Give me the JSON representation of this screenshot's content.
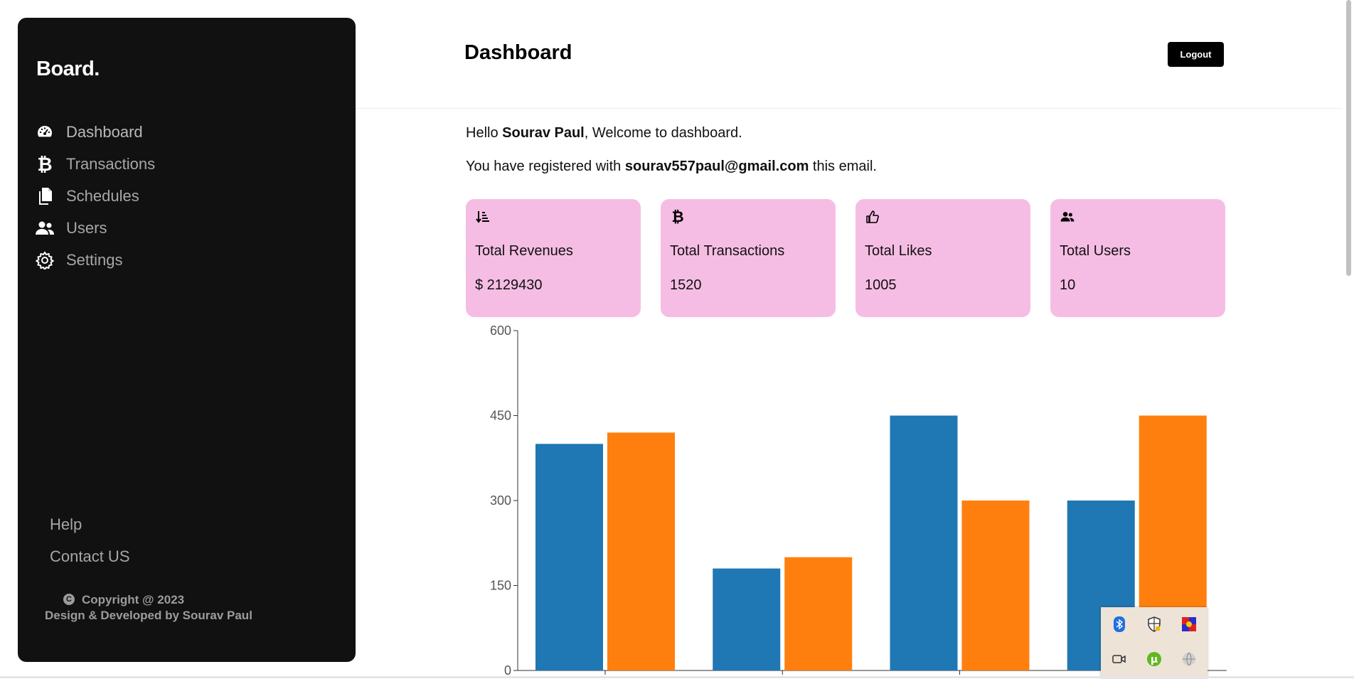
{
  "sidebar": {
    "brand": "Board.",
    "nav": [
      {
        "label": "Dashboard",
        "icon": "gauge-icon"
      },
      {
        "label": "Transactions",
        "icon": "bitcoin-icon"
      },
      {
        "label": "Schedules",
        "icon": "documents-icon"
      },
      {
        "label": "Users",
        "icon": "users-icon"
      },
      {
        "label": "Settings",
        "icon": "gear-icon"
      }
    ],
    "help": "Help",
    "contact": "Contact US",
    "copyright": "Copyright @ 2023",
    "credits": "Design & Developed by Sourav Paul"
  },
  "header": {
    "title": "Dashboard",
    "logout": "Logout"
  },
  "welcome": {
    "hello": "Hello ",
    "name": "Sourav Paul",
    "welcome_text": ", Welcome to dashboard.",
    "registered_prefix": "You have registered with ",
    "email": "sourav557paul@gmail.com",
    "registered_suffix": " this email."
  },
  "cards": [
    {
      "title": "Total Revenues",
      "value": "$ 2129430",
      "icon": "sort-amount-icon"
    },
    {
      "title": "Total Transactions",
      "value": "1520",
      "icon": "bitcoin-icon"
    },
    {
      "title": "Total Likes",
      "value": "1005",
      "icon": "thumbs-up-icon"
    },
    {
      "title": "Total Users",
      "value": "10",
      "icon": "users-icon"
    }
  ],
  "colors": {
    "sidebar_bg": "#111111",
    "card_bg": "#f6bde4",
    "series_a": "#1f77b4",
    "series_b": "#ff7f0e"
  },
  "chart_data": {
    "type": "bar",
    "title": "",
    "xlabel": "",
    "ylabel": "",
    "ylim": [
      0,
      600
    ],
    "yticks": [
      0,
      150,
      300,
      450,
      600
    ],
    "categories": [
      "",
      "",
      "",
      ""
    ],
    "series": [
      {
        "values": [
          400,
          180,
          450,
          300
        ],
        "color": "#1f77b4"
      },
      {
        "values": [
          420,
          200,
          300,
          450
        ],
        "color": "#ff7f0e"
      }
    ],
    "grid": false,
    "legend": "none"
  },
  "tray": {
    "icons": [
      "bluetooth-icon",
      "security-shield-icon",
      "media-app-icon",
      "camera-icon",
      "utorrent-icon",
      "network-globe-icon"
    ]
  }
}
